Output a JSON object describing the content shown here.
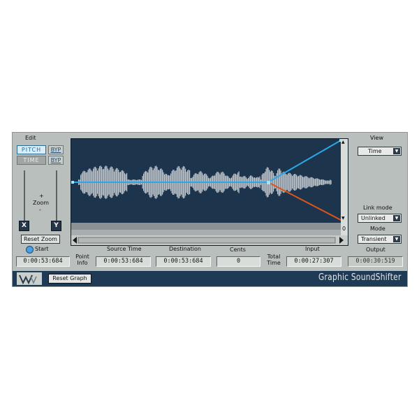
{
  "edit": {
    "label": "Edit",
    "pitch_label": "PITCH",
    "time_label": "TIME",
    "byp_label": "BYP",
    "zoom_plus": "+",
    "zoom_label": "Zoom",
    "zoom_minus": "-",
    "x_label": "X",
    "y_label": "Y",
    "reset_zoom_label": "Reset Zoom"
  },
  "view": {
    "label": "View",
    "value": "Time"
  },
  "link_mode": {
    "label": "Link mode",
    "value": "Unlinked"
  },
  "mode": {
    "label": "Mode",
    "value": "Transient"
  },
  "graph": {
    "scroll_label": "0",
    "colors": {
      "background": "#1d344d",
      "pitch_line": "#2aa8e8",
      "time_line": "#e0541a",
      "waveform": "#cfd4d8"
    }
  },
  "readouts": {
    "start_label": "Start",
    "start_value": "0:00:53:684",
    "point_info_label": "Point Info",
    "source_time_label": "Source Time",
    "source_time_value": "0:00:53:684",
    "destination_label": "Destination",
    "destination_value": "0:00:53:684",
    "cents_label": "Cents",
    "cents_value": "0",
    "total_time_label": "Total Time",
    "input_label": "Input",
    "input_value": "0:00:27:307",
    "output_label": "Output",
    "output_value": "0:00:30:519"
  },
  "footer": {
    "reset_graph_label": "Reset Graph",
    "title": "Graphic SoundShifter",
    "logo_icon": "waves-logo-icon"
  }
}
